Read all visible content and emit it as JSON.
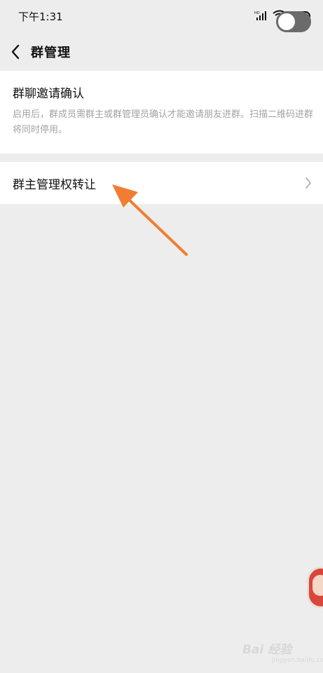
{
  "status_bar": {
    "time": "下午1:31",
    "network": "HD",
    "battery": "80"
  },
  "nav": {
    "title": "群管理"
  },
  "invite_confirm": {
    "title": "群聊邀请确认",
    "enabled": false,
    "description": "启用后，群成员需群主或群管理员确认才能邀请朋友进群。扫描二维码进群将同时停用。"
  },
  "transfer": {
    "label": "群主管理权转让"
  },
  "watermark": {
    "text": "Bai 经验",
    "sub": "jingyan.baidu.com"
  },
  "colors": {
    "background": "#ededed",
    "card": "#ffffff",
    "toggle_off": "#6b6b6b",
    "arrow": "#f07d32",
    "desc_text": "#a3a3a3"
  }
}
